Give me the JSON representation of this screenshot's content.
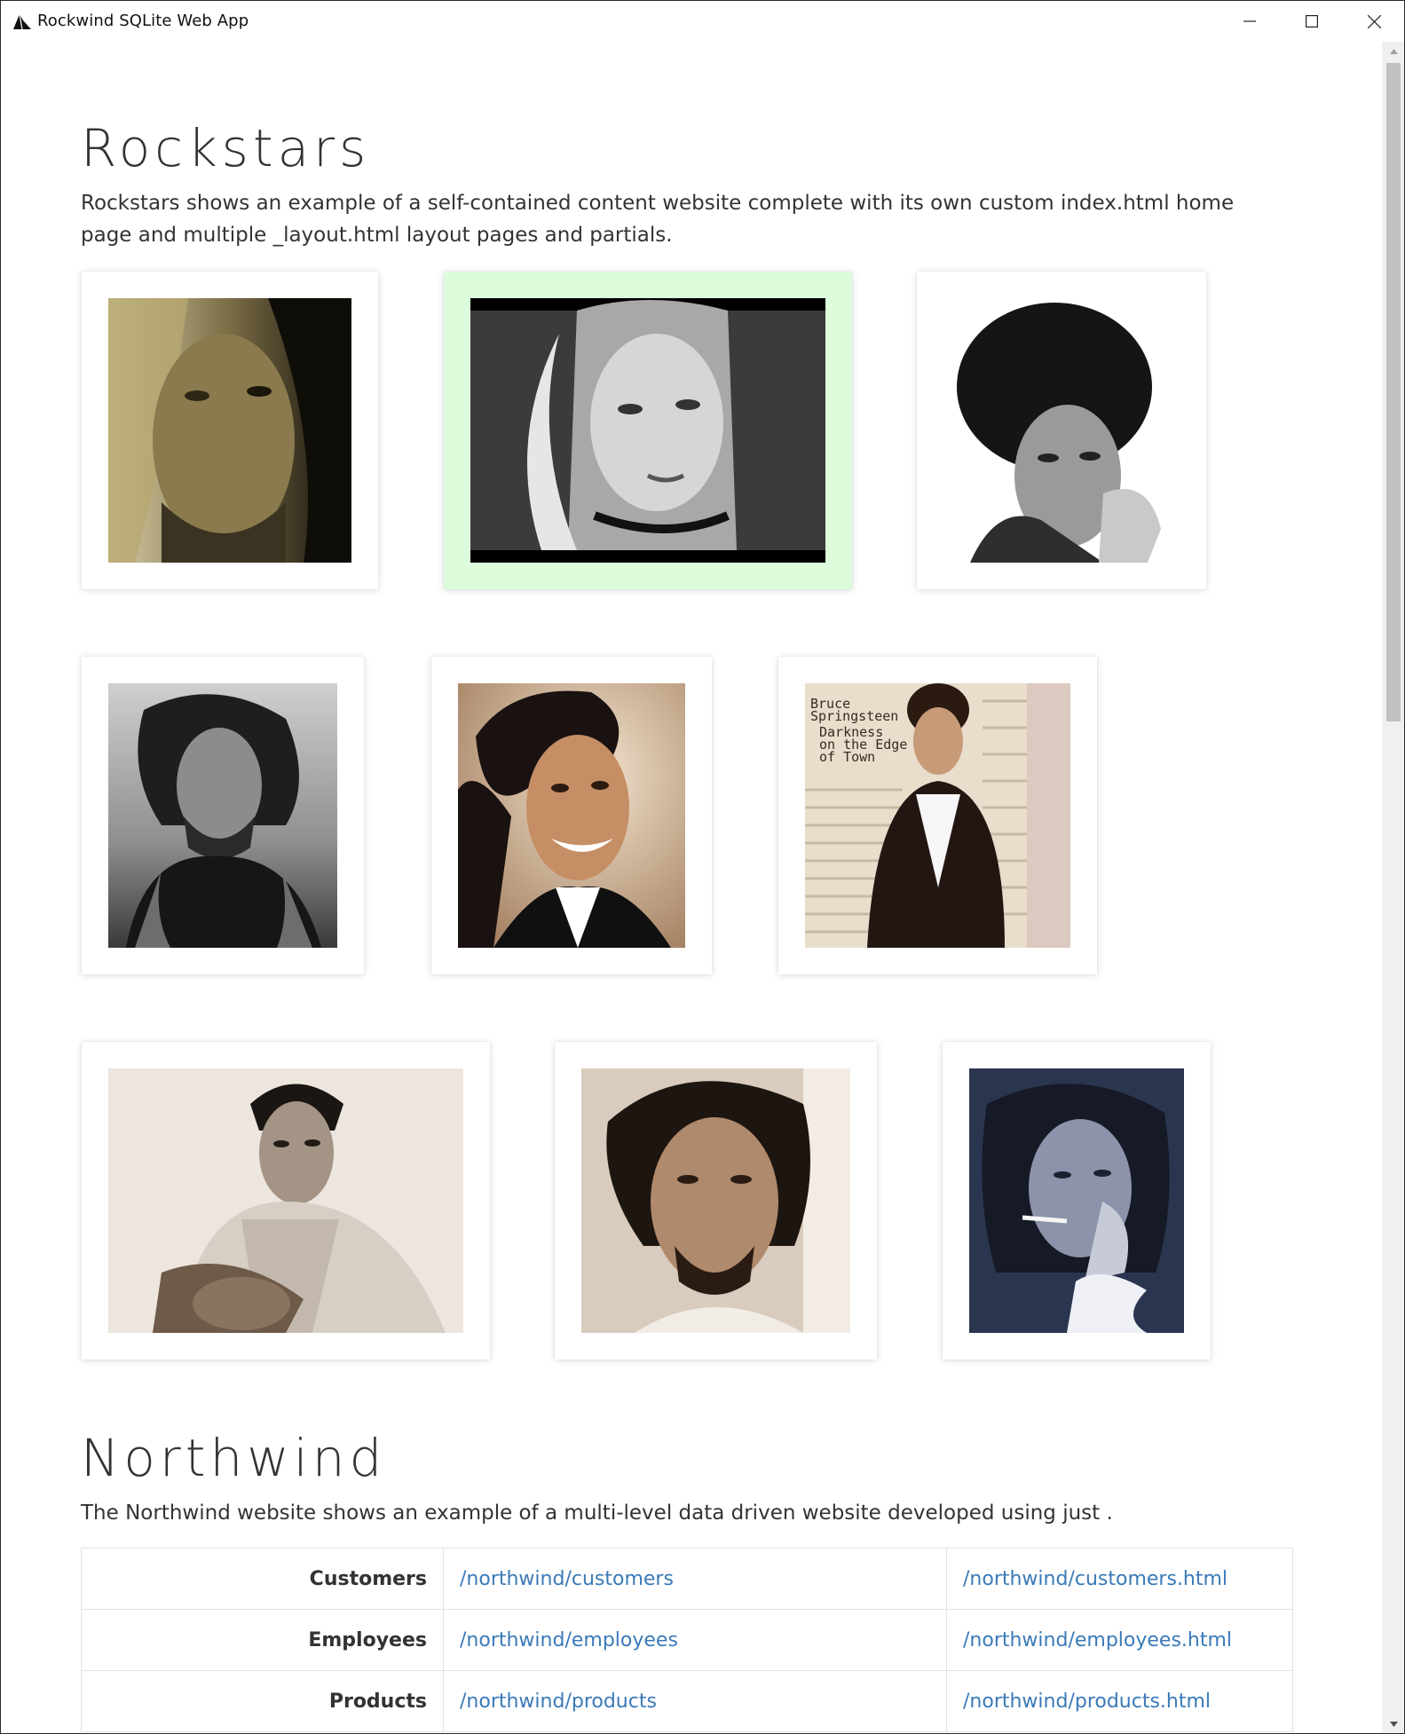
{
  "window": {
    "title": "Rockwind SQLite Web App",
    "icons": {
      "logo": "rockwind-logo-icon",
      "minimize": "minimize-icon",
      "maximize": "maximize-icon",
      "close": "close-icon"
    }
  },
  "rockstars": {
    "title": "Rockstars",
    "description": "Rockstars shows an example of a self-contained content website complete with its own custom index.html home page and multiple _layout.html layout pages and partials.",
    "highlight_color": "#dcfcdc",
    "cards": [
      {
        "portrait": "long blonde hair, bearded man, sepia"
      },
      {
        "portrait": "blonde woman, black and white"
      },
      {
        "portrait": "curly afro hair, black and white"
      },
      {
        "portrait": "windswept hair, sleeveless shirt, black and white"
      },
      {
        "portrait": "smiling man, curly hair, color"
      },
      {
        "portrait": "Bruce Springsteen album cover"
      },
      {
        "portrait": "man with guitar, black and white"
      },
      {
        "portrait": "dark shaggy hair, bearded man"
      },
      {
        "portrait": "woman with hand on cheek, blue tint"
      }
    ],
    "album_text": [
      "Bruce",
      "Springsteen",
      "Darkness",
      "on the Edge",
      "of Town"
    ]
  },
  "northwind": {
    "title": "Northwind",
    "description": "The Northwind website shows an example of a multi-level data driven website developed using just .",
    "link_color": "#3a7ab8",
    "rows": [
      {
        "name": "Customers",
        "route": "/northwind/customers",
        "page": "/northwind/customers.html"
      },
      {
        "name": "Employees",
        "route": "/northwind/employees",
        "page": "/northwind/employees.html"
      },
      {
        "name": "Products",
        "route": "/northwind/products",
        "page": "/northwind/products.html"
      }
    ]
  },
  "scrollbar": {
    "position": 0.0
  }
}
